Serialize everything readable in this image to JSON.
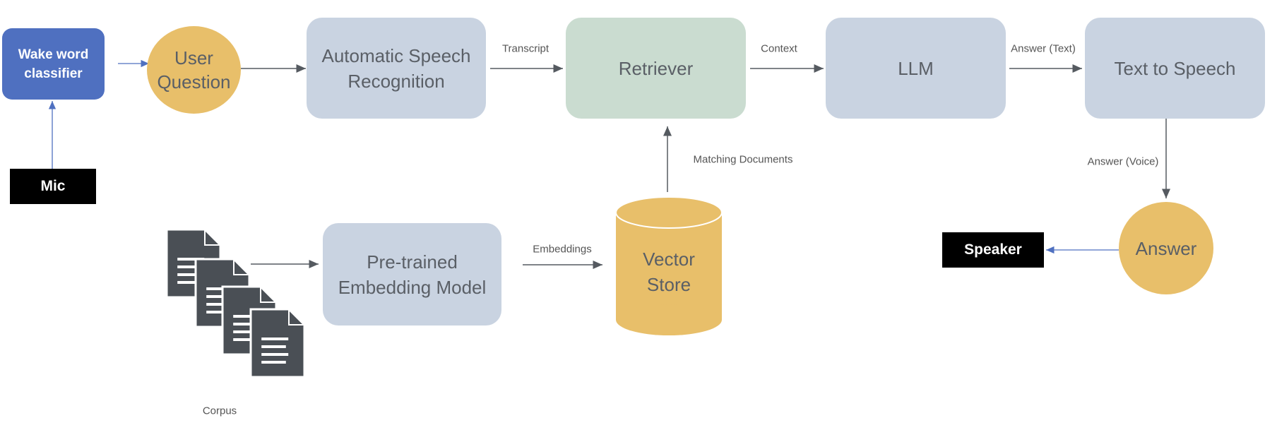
{
  "nodes": {
    "wake_word": "Wake word classifier",
    "mic": "Mic",
    "user_question": "User Question",
    "asr": "Automatic Speech Recognition",
    "retriever": "Retriever",
    "llm": "LLM",
    "tts": "Text to Speech",
    "answer": "Answer",
    "speaker": "Speaker",
    "vector_store": "Vector Store",
    "embedding_model": "Pre-trained Embedding Model",
    "corpus": "Corpus"
  },
  "edges": {
    "transcript": "Transcript",
    "context": "Context",
    "answer_text": "Answer (Text)",
    "answer_voice": "Answer (Voice)",
    "matching_documents": "Matching Documents",
    "embeddings": "Embeddings"
  },
  "colors": {
    "wake": "#4f70c0",
    "gray_box": "#c9d3e1",
    "green_box": "#cadcd0",
    "yellow": "#e8bf6a",
    "doc_icon": "#4a4f55",
    "arrow": "#555a60",
    "blue_arrow": "#4f70c0"
  }
}
